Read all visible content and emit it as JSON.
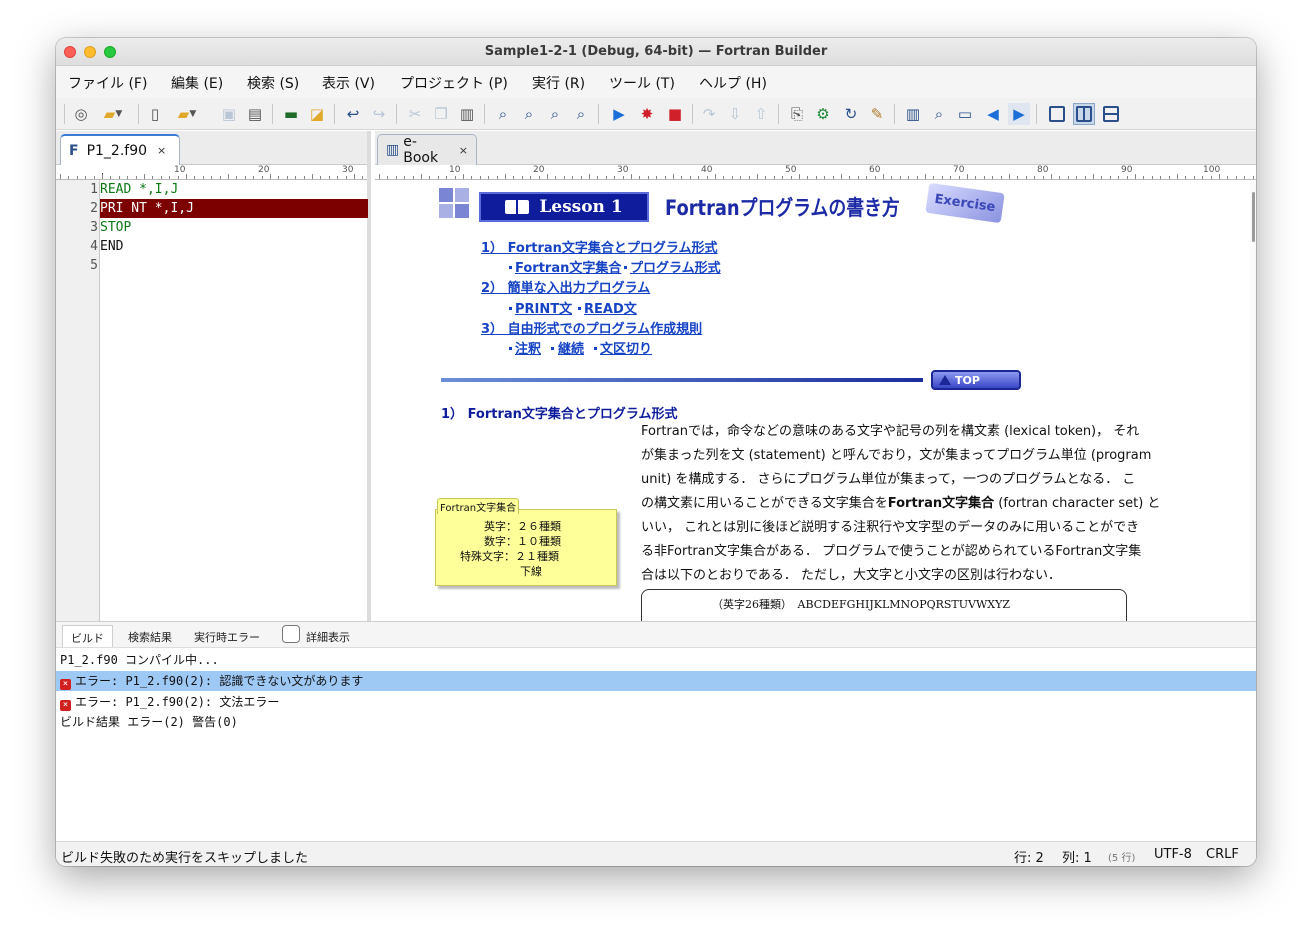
{
  "window": {
    "title": "Sample1-2-1 (Debug, 64-bit) — Fortran Builder"
  },
  "menus": [
    "ファイル (F)",
    "編集 (E)",
    "検索 (S)",
    "表示 (V)",
    "プロジェクト (P)",
    "実行 (R)",
    "ツール (T)",
    "ヘルプ (H)"
  ],
  "editor": {
    "tab_label": "P1_2.f90",
    "tab_close": "×",
    "ruler_labels": [
      "10",
      "20",
      "30"
    ],
    "lines": [
      {
        "num": "1",
        "text": "READ *,I,J"
      },
      {
        "num": "2",
        "text": "PRI NT *,I,J"
      },
      {
        "num": "3",
        "text": "STOP"
      },
      {
        "num": "4",
        "text": "END"
      },
      {
        "num": "5",
        "text": ""
      }
    ]
  },
  "ebook": {
    "tab_label": "e-Book",
    "tab_close": "×",
    "ruler_labels": [
      "10",
      "20",
      "30",
      "40",
      "50",
      "60",
      "70",
      "80",
      "90",
      "100"
    ],
    "lesson_label": "Lesson 1",
    "lesson_title": "Fortranプログラムの書き方",
    "exercise_label": "Exercise",
    "toc": {
      "s1": "1） Fortran文字集合とプログラム形式",
      "s1a": "Fortran文字集合",
      "s1b": "プログラム形式",
      "s2": "2） 簡単な入出力プログラム",
      "s2a": "PRINT文",
      "s2b": "READ文",
      "s3": "3） 自由形式でのプログラム作成規則",
      "s3a": "注釈",
      "s3b": "継続",
      "s3c": "文区切り"
    },
    "top_button": "TOP",
    "section_title": "1） Fortran文字集合とプログラム形式",
    "note": {
      "tab": "Fortran文字集合",
      "l1": "英字：２６種類",
      "l2": "数字：１０種類",
      "l3": "特殊文字：２１種類",
      "l4": "下線"
    },
    "paragraph": {
      "l1": "Fortranでは，命令などの意味のある文字や記号の列を構文素 (lexical token)， それ",
      "l2": "が集まった列を文 (statement) と呼んでおり，文が集まってプログラム単位 (program",
      "l3": "unit) を構成する． さらにプログラム単位が集まって，一つのプログラムとなる． こ",
      "l4a": "の構文素に用いることができる文字集合を",
      "l4b": "Fortran文字集合",
      "l4c": " (fortran character set) と",
      "l5": "いい， これとは別に後ほど説明する注釈行や文字型のデータのみに用いることができ",
      "l6": "る非Fortran文字集合がある． プログラムで使うことが認められているFortran文字集",
      "l7": "合は以下のとおりである． ただし，大文字と小文字の区別は行わない．"
    },
    "char_table_row": "（英字26種類）　ABCDEFGHIJKLMNOPQRSTUVWXYZ"
  },
  "output": {
    "tabs": [
      "ビルド",
      "検索結果",
      "実行時エラー"
    ],
    "detail_label": "詳細表示",
    "lines": [
      "P1_2.f90 コンパイル中...",
      "エラー: P1_2.f90(2): 認識できない文があります",
      "エラー: P1_2.f90(2): 文法エラー",
      "ビルド結果 エラー(2)  警告(0)"
    ]
  },
  "status": {
    "message": "ビルド失敗のため実行をスキップしました",
    "row": "行: 2",
    "col": "列: 1",
    "lines": "(5 行)",
    "encoding": "UTF-8",
    "eol": "CRLF"
  },
  "colors": {
    "error_line": "#7d0000",
    "selection": "#9ec9f5",
    "link": "#1543c4",
    "accent": "#0f1d9c"
  }
}
